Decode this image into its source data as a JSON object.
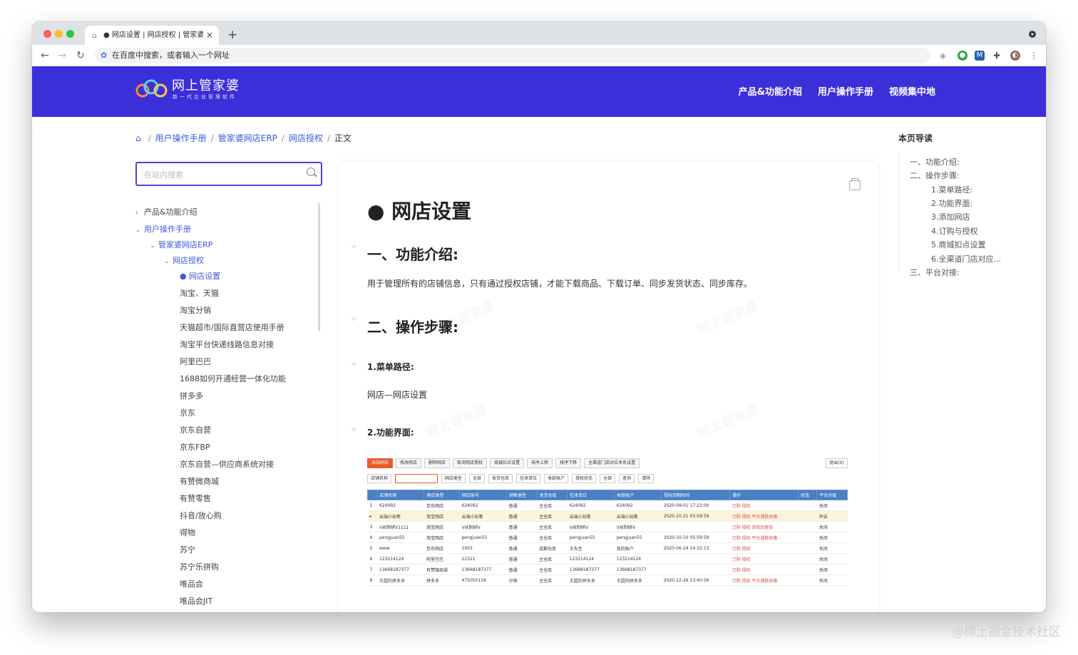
{
  "browser": {
    "tab_title": "● 网店设置 | 网店授权 | 管家婆网店ERP",
    "address_placeholder": "在百度中搜索，或者输入一个网址",
    "new_tab": "+",
    "close": "×"
  },
  "site": {
    "logo_title": "网上管家婆",
    "logo_sub": "新一代企业管理软件",
    "nav": [
      "产品&功能介绍",
      "用户操作手册",
      "视频集中地"
    ]
  },
  "breadcrumb": {
    "items": [
      "用户操作手册",
      "管家婆网店ERP",
      "网店授权"
    ],
    "current": "正文"
  },
  "search": {
    "placeholder": "在站内搜索"
  },
  "sidebar": {
    "items": [
      {
        "label": "产品&功能介绍"
      },
      {
        "label": "用户操作手册"
      },
      {
        "label": "管家婆网店ERP"
      },
      {
        "label": "网店授权"
      },
      {
        "label": "● 网店设置"
      },
      {
        "label": "淘宝、天猫"
      },
      {
        "label": "淘宝分销"
      },
      {
        "label": "天猫超市/国际直营店使用手册"
      },
      {
        "label": "淘宝平台快递线路信息对接"
      },
      {
        "label": "阿里巴巴"
      },
      {
        "label": "1688如何开通经营一体化功能"
      },
      {
        "label": "拼多多"
      },
      {
        "label": "京东"
      },
      {
        "label": "京东自营"
      },
      {
        "label": "京东FBP"
      },
      {
        "label": "京东自营—供应商系统对接"
      },
      {
        "label": "有赞微商城"
      },
      {
        "label": "有赞零售"
      },
      {
        "label": "抖音/放心购"
      },
      {
        "label": "得物"
      },
      {
        "label": "苏宁"
      },
      {
        "label": "苏宁乐拼购"
      },
      {
        "label": "唯品会"
      },
      {
        "label": "唯品会JIT"
      }
    ]
  },
  "article": {
    "title": "● 网店设置",
    "sec1_title": "一、功能介绍:",
    "sec1_body": "用于管理所有的店铺信息，只有通过授权店铺，才能下载商品、下载订单、同步发货状态、同步库存。",
    "sec2_title": "二、操作步骤:",
    "step1_title": "1.菜单路径:",
    "step1_body": "网店—网店设置",
    "step2_title": "2.功能界面:",
    "watermark": "网上管家婆"
  },
  "screenshot": {
    "buttons": [
      "添加网店",
      "修改网店",
      "删除网店",
      "取消网店授权",
      "商城扣点设置",
      "排序上移",
      "排序下移",
      "全渠道门店对应关系设置"
    ],
    "exit": "退出(X)",
    "filters": [
      "店铺名称",
      "网店类型",
      "全部",
      "发货仓库",
      "往来单位",
      "收款账户",
      "授权状态",
      "全部",
      "查询",
      "清除"
    ],
    "columns": [
      "店铺名称",
      "网店类型",
      "网店账号",
      "销售类型",
      "发货仓库",
      "往来单位",
      "收款账户",
      "授权到期时间",
      "操作",
      "状态",
      "平台对接"
    ],
    "rows": [
      [
        "1",
        "624092",
        "京东网店",
        "624092",
        "普通",
        "主仓库",
        "624092",
        "624092",
        "2020-09-01 17:22:00",
        "订购 授权",
        "",
        "关闭"
      ],
      [
        "▸",
        "云端小玩笔",
        "淘宝网店",
        "云端小玩笔",
        "普通",
        "主仓库",
        "云端小玩笔",
        "云端小玩笔",
        "2020-10-21 05:59:59",
        "订购 授权 平台遇数收缴",
        "",
        "开启"
      ],
      [
        "3",
        "V丝制研V1111",
        "淘宝网店",
        "V丝制研V",
        "普通",
        "主仓库",
        "V丝制研V",
        "V丝制研V",
        "",
        "订购 授权 获取后题目",
        "",
        "关闭"
      ],
      [
        "4",
        "pengjuan55",
        "淘宝网店",
        "pengjuan55",
        "普通",
        "主仓库",
        "pengjuan55",
        "pengjuan55",
        "2020-10-10 05:59:59",
        "订购 授权 平台遇数收缴",
        "",
        "关闭"
      ],
      [
        "5",
        "www",
        "京东网店",
        "1455",
        "普通",
        "成都仓库",
        "王先生",
        "我的账户",
        "2020-06-24 14:32:13",
        "订购 授权",
        "",
        "关闭"
      ],
      [
        "6",
        "123214124",
        "阿里巴巴",
        "12321",
        "普通",
        "主仓库",
        "123214124",
        "123214124",
        "",
        "订购 授权",
        "",
        "关闭"
      ],
      [
        "7",
        "13668187377",
        "有赞微商城",
        "13668187377",
        "普通",
        "主仓库",
        "13668187377",
        "13668187377",
        "",
        "订购 授权",
        "",
        "关闭"
      ],
      [
        "8",
        "王超的拼多多",
        "拼多多",
        "475050118",
        "分销",
        "主仓库",
        "王超的拼多多",
        "王超的拼多多",
        "2020-12-26 13:40:56",
        "订购 授权 平台遇数收缴",
        "",
        "关闭"
      ]
    ]
  },
  "toc": {
    "title": "本页导读",
    "items": [
      "一、功能介绍:",
      "二、操作步骤:",
      "1.菜单路径:",
      "2.功能界面:",
      "3.添加网店",
      "4.订购与授权",
      "5.商城扣点设置",
      "6.全渠道门店对应...",
      "三、平台对接:"
    ]
  },
  "page_watermark": "@稀土掘金技术社区",
  "colors": {
    "header": "#3b2fd9",
    "link": "#3b5bdb",
    "accent_border": "#4a45d8",
    "table_header": "#4a7fc4"
  }
}
